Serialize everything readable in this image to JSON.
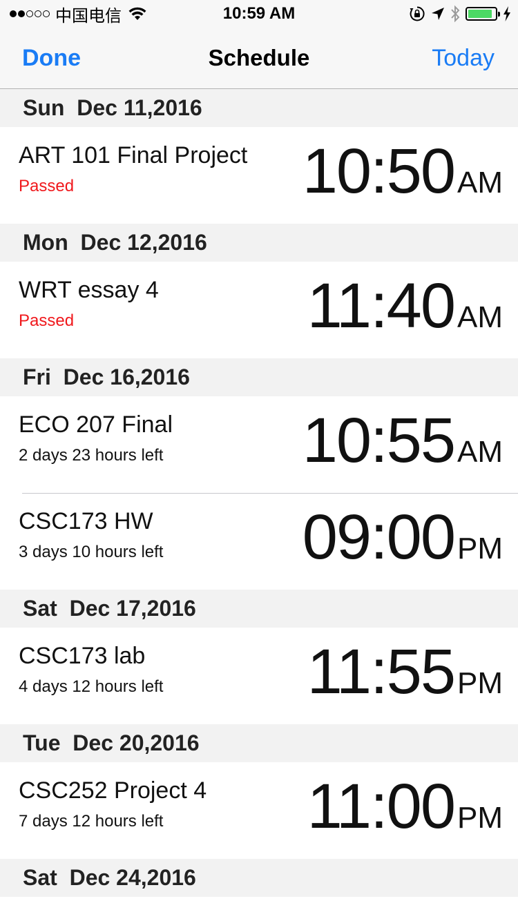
{
  "status": {
    "carrier": "中国电信",
    "time": "10:59 AM",
    "battery_level": 0.9
  },
  "nav": {
    "left": "Done",
    "title": "Schedule",
    "right": "Today"
  },
  "sections": [
    {
      "header": "Sun  Dec 11,2016",
      "items": [
        {
          "title": "ART 101 Final Project",
          "status": "Passed",
          "passed": true,
          "time": "10:50",
          "ampm": "AM"
        }
      ]
    },
    {
      "header": "Mon  Dec 12,2016",
      "items": [
        {
          "title": "WRT essay 4",
          "status": "Passed",
          "passed": true,
          "time": "11:40",
          "ampm": "AM"
        }
      ]
    },
    {
      "header": "Fri  Dec 16,2016",
      "items": [
        {
          "title": "ECO 207 Final",
          "status": "2 days 23 hours left",
          "passed": false,
          "time": "10:55",
          "ampm": "AM"
        },
        {
          "title": "CSC173 HW",
          "status": "3 days 10 hours left",
          "passed": false,
          "time": "09:00",
          "ampm": "PM"
        }
      ]
    },
    {
      "header": "Sat  Dec 17,2016",
      "items": [
        {
          "title": "CSC173 lab",
          "status": "4 days 12 hours left",
          "passed": false,
          "time": "11:55",
          "ampm": "PM"
        }
      ]
    },
    {
      "header": "Tue  Dec 20,2016",
      "items": [
        {
          "title": "CSC252 Project 4",
          "status": "7 days 12 hours left",
          "passed": false,
          "time": "11:00",
          "ampm": "PM"
        }
      ]
    },
    {
      "header": "Sat  Dec 24,2016",
      "items": []
    }
  ],
  "colors": {
    "accent": "#1a7cf5",
    "passed": "#f0181c",
    "battery": "#4cd964"
  },
  "icons": [
    "wifi-icon",
    "rotation-lock-icon",
    "location-arrow-icon",
    "bluetooth-icon",
    "battery-icon",
    "charging-bolt-icon"
  ]
}
